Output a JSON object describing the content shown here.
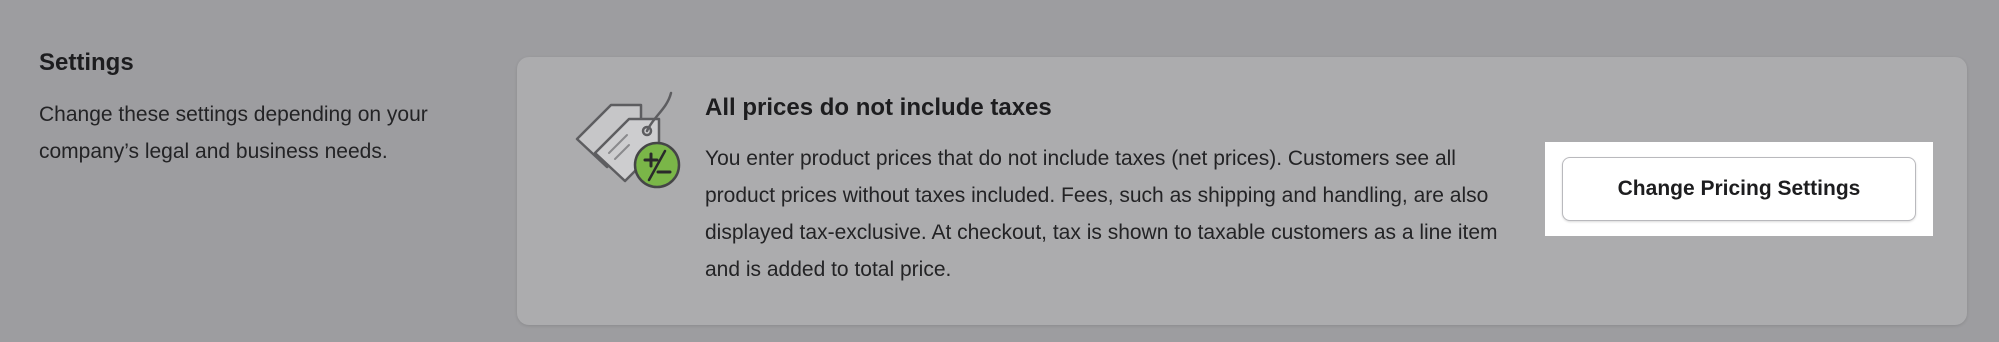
{
  "settings": {
    "title": "Settings",
    "description": "Change these settings depending on your company’s legal and business needs."
  },
  "pricing_card": {
    "icon": "price-tag-tax-icon",
    "title": "All prices do not include taxes",
    "description": "You enter product prices that do not include taxes (net prices). Customers see all product prices without taxes included. Fees, such as shipping and handling, are also displayed tax-exclusive. At checkout, tax is shown to taxable customers as a line item and is added to total price.",
    "button_label": "Change Pricing Settings"
  },
  "colors": {
    "page_background": "#9d9da0",
    "card_background": "#acacae",
    "badge_green": "#7ab648",
    "text": "#1d1d1f"
  }
}
